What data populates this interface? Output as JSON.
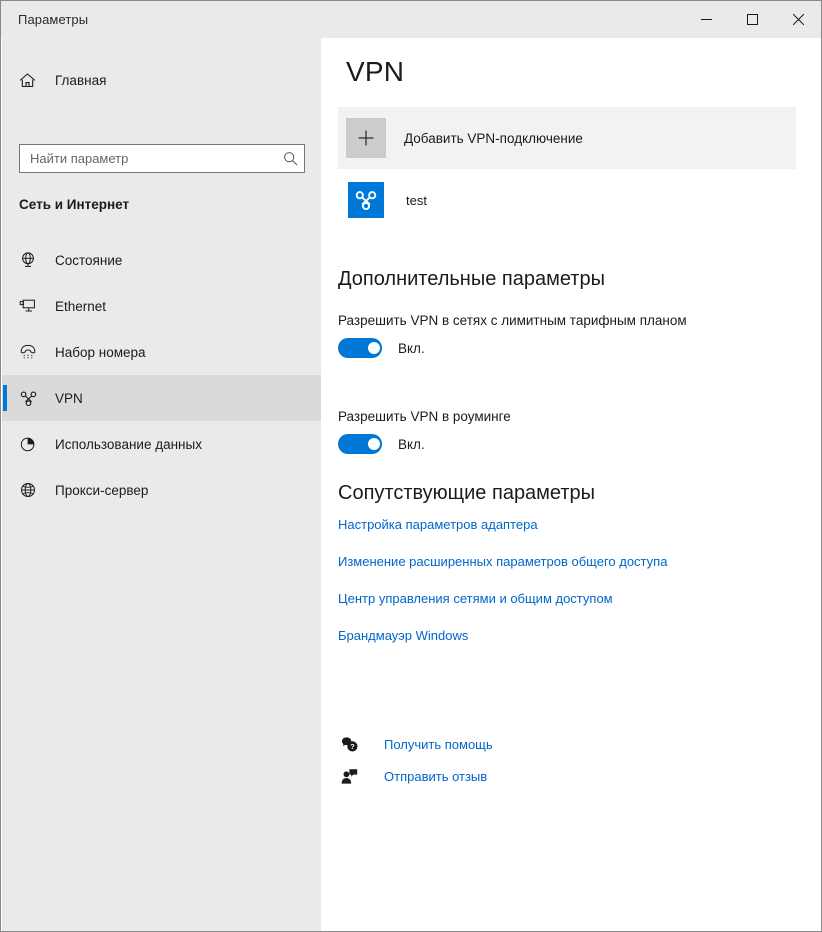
{
  "window": {
    "title": "Параметры",
    "controls": {
      "minimize": "minimize-icon",
      "maximize": "maximize-icon",
      "close": "close-icon"
    }
  },
  "sidebar": {
    "home": {
      "label": "Главная",
      "icon": "home-icon"
    },
    "search": {
      "placeholder": "Найти параметр",
      "value": "",
      "icon": "search-icon"
    },
    "section_heading": "Сеть и Интернет",
    "items": [
      {
        "label": "Состояние",
        "icon": "network-status-icon",
        "selected": false
      },
      {
        "label": "Ethernet",
        "icon": "ethernet-icon",
        "selected": false
      },
      {
        "label": "Набор номера",
        "icon": "dial-up-phone-icon",
        "selected": false
      },
      {
        "label": "VPN",
        "icon": "vpn-knot-icon",
        "selected": true
      },
      {
        "label": "Использование данных",
        "icon": "pie-chart-icon",
        "selected": false
      },
      {
        "label": "Прокси-сервер",
        "icon": "globe-icon",
        "selected": false
      }
    ]
  },
  "main": {
    "page_title": "VPN",
    "add_connection": {
      "label": "Добавить VPN-подключение",
      "icon": "plus-icon"
    },
    "connections": [
      {
        "name": "test",
        "icon": "vpn-knot-icon"
      }
    ],
    "advanced": {
      "heading": "Дополнительные параметры",
      "toggles": [
        {
          "caption": "Разрешить VPN в сетях с лимитным тарифным планом",
          "state_label": "Вкл.",
          "on": true
        },
        {
          "caption": "Разрешить VPN в роуминге",
          "state_label": "Вкл.",
          "on": true
        }
      ]
    },
    "related": {
      "heading": "Сопутствующие параметры",
      "links": [
        "Настройка параметров адаптера",
        "Изменение расширенных параметров общего доступа",
        "Центр управления сетями и общим доступом",
        "Брандмауэр Windows"
      ]
    },
    "help": [
      {
        "label": "Получить помощь",
        "icon": "help-bubble-icon"
      },
      {
        "label": "Отправить отзыв",
        "icon": "feedback-person-icon"
      }
    ]
  },
  "colors": {
    "accent": "#0078d7",
    "link": "#0066cc",
    "sidebar_bg": "#eaeaea",
    "content_bg": "#ffffff",
    "row_hover_bg": "#f2f2f2",
    "plus_button_bg": "#cccccc",
    "text": "#1b1b1b"
  }
}
